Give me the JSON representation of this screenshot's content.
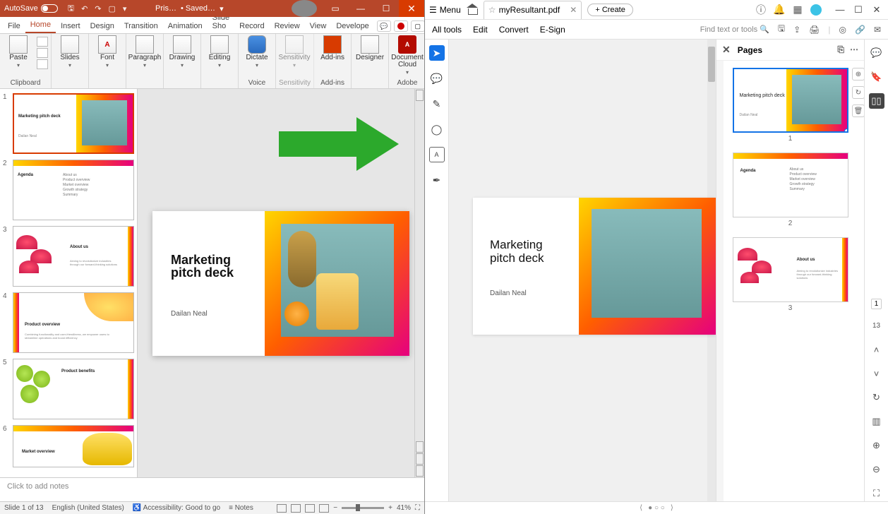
{
  "ppt": {
    "autosave_label": "AutoSave",
    "doc_name": "Pris…",
    "doc_status": "• Saved…",
    "tabs": [
      "File",
      "Home",
      "Insert",
      "Design",
      "Transition",
      "Animation",
      "Slide Sho",
      "Record",
      "Review",
      "View",
      "Develope"
    ],
    "active_tab": "Home",
    "ribbon": {
      "clipboard": "Clipboard",
      "paste": "Paste",
      "slides": "Slides",
      "font_group": "Font",
      "font_btn": "Font",
      "paragraph": "Paragraph",
      "drawing": "Drawing",
      "editing": "Editing",
      "voice": "Voice",
      "dictate": "Dictate",
      "sensitivity": "Sensitivity",
      "sensitivity_btn": "Sensitivity",
      "addins": "Add-ins",
      "addins_btn": "Add-ins",
      "designer": "Designer",
      "adobe": "Adobe",
      "doc_cloud": "Document Cloud"
    },
    "slide_title": "Marketing pitch deck",
    "slide_author": "Dailan Neal",
    "notes_placeholder": "Click to add notes",
    "thumbs": {
      "s1": {
        "title": "Marketing pitch deck",
        "sub": "Dailan Neal"
      },
      "s2": {
        "title": "Agenda",
        "items": [
          "About us",
          "Product overview",
          "Market overview",
          "Growth strategy",
          "Summary"
        ]
      },
      "s3": {
        "title": "About us",
        "sub": "Aiming to revolutionize industries through our forward-thinking solutions"
      },
      "s4": {
        "title": "Product overview",
        "sub": "Combining functionality and user-friendliness, we empower users to streamline operations and boost efficiency"
      },
      "s5": {
        "title": "Product benefits"
      },
      "s6": {
        "title": "Market overview"
      }
    },
    "status": {
      "slide": "Slide 1 of 13",
      "lang": "English (United States)",
      "access": "Accessibility: Good to go",
      "notes": "Notes",
      "zoom": "41%"
    }
  },
  "acro": {
    "menu": "Menu",
    "tab_name": "myResultant.pdf",
    "create": "Create",
    "bar2": [
      "All tools",
      "Edit",
      "Convert",
      "E-Sign"
    ],
    "search_placeholder": "Find text or tools",
    "pages_title": "Pages",
    "page_title": "Marketing pitch deck",
    "page_author": "Dailan Neal",
    "mini2": {
      "title": "Agenda",
      "items": [
        "About us",
        "Product overview",
        "Market overview",
        "Growth strategy",
        "Summary"
      ]
    },
    "mini3": {
      "title": "About us",
      "sub": "Aiming to revolutionize industries through our forward-thinking solutions"
    },
    "nums": {
      "p1": "1",
      "p2": "2",
      "p3": "3"
    },
    "rail_page": "1",
    "rail_total": "13"
  }
}
